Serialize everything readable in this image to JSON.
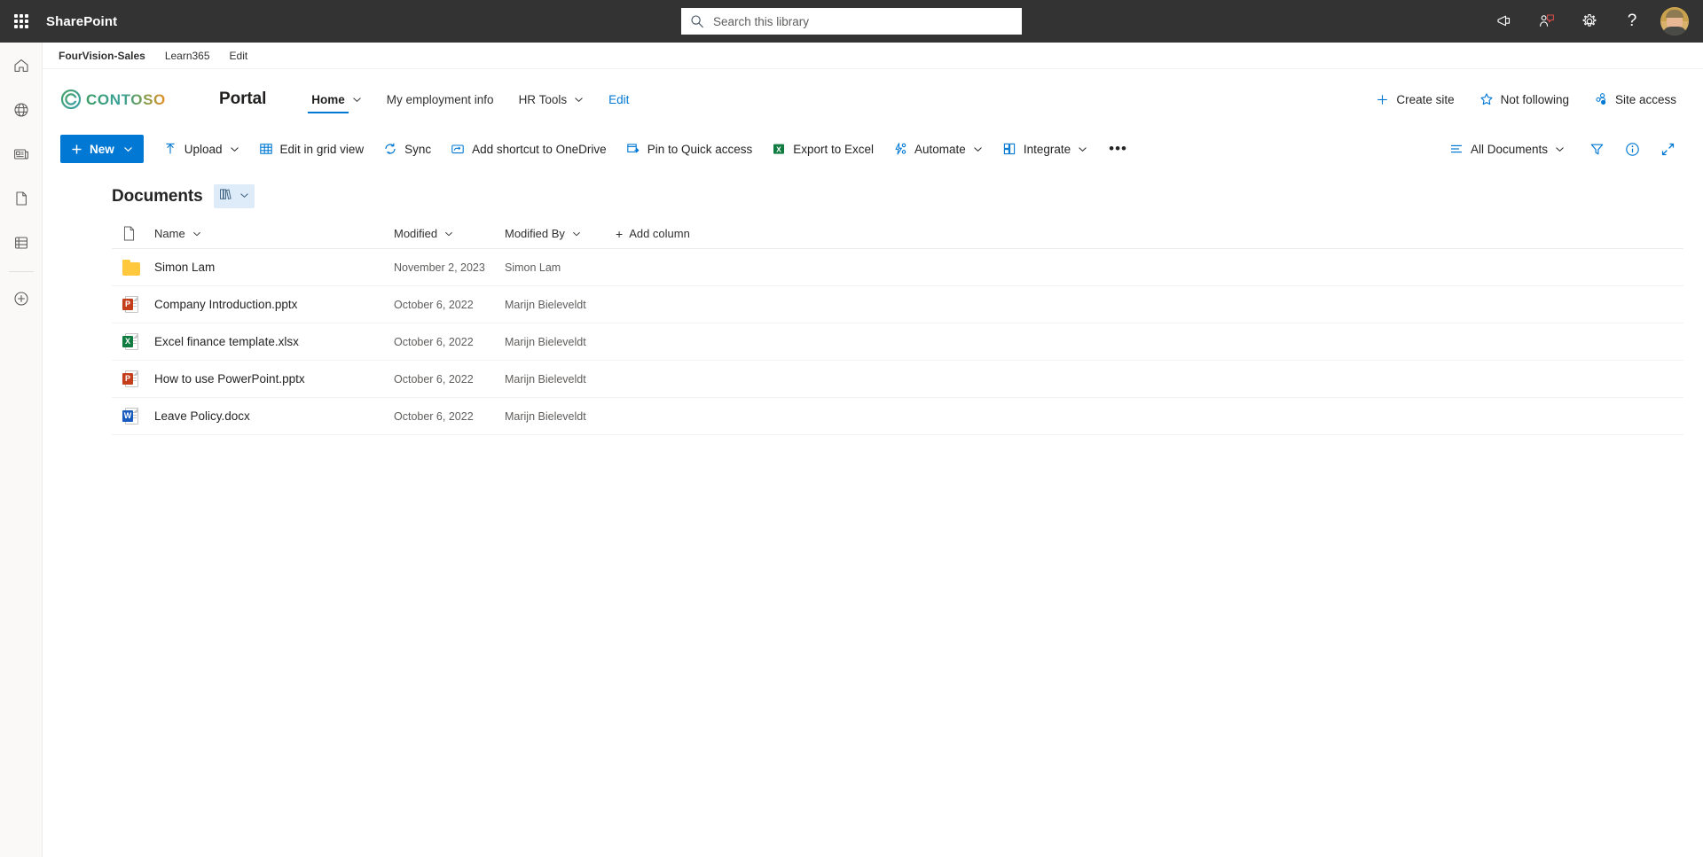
{
  "suite": {
    "waffle_label": "app-launcher",
    "app_name": "SharePoint",
    "search_placeholder": "Search this library",
    "search_value": "",
    "icons": [
      {
        "name": "megaphone-icon",
        "label": "Announcements"
      },
      {
        "name": "feedback-icon",
        "label": "Feedback"
      },
      {
        "name": "gear-icon",
        "label": "Settings"
      },
      {
        "name": "help-icon",
        "label": "?"
      }
    ],
    "avatar_label": "User account"
  },
  "rail": {
    "items": [
      {
        "name": "home-icon",
        "label": "Home"
      },
      {
        "name": "globe-icon",
        "label": "My sites"
      },
      {
        "name": "news-icon",
        "label": "News"
      },
      {
        "name": "page-icon",
        "label": "Files"
      },
      {
        "name": "lists-icon",
        "label": "Lists"
      },
      {
        "name": "create-icon",
        "label": "Create"
      }
    ]
  },
  "hubnav": {
    "items": [
      {
        "label": "FourVision-Sales",
        "bold": true
      },
      {
        "label": "Learn365",
        "bold": false
      },
      {
        "label": "Edit",
        "bold": false
      }
    ]
  },
  "site_header": {
    "logo_text": "CONTOSO",
    "site_title": "Portal",
    "nav": [
      {
        "label": "Home",
        "active": true,
        "has_chevron": true
      },
      {
        "label": "My employment info",
        "active": false,
        "has_chevron": false
      },
      {
        "label": "HR Tools",
        "active": false,
        "has_chevron": true
      },
      {
        "label": "Edit",
        "active": false,
        "has_chevron": false,
        "link": true
      }
    ],
    "actions": [
      {
        "label": "Create site",
        "icon": "plus-icon"
      },
      {
        "label": "Not following",
        "icon": "star-icon"
      },
      {
        "label": "Site access",
        "icon": "people-icon"
      }
    ]
  },
  "command_bar": {
    "new_label": "New",
    "commands": [
      {
        "label": "Upload",
        "icon": "upload-icon",
        "chevron": true
      },
      {
        "label": "Edit in grid view",
        "icon": "grid-icon",
        "chevron": false
      },
      {
        "label": "Sync",
        "icon": "sync-icon",
        "chevron": false
      },
      {
        "label": "Add shortcut to OneDrive",
        "icon": "onedrive-shortcut-icon",
        "chevron": false
      },
      {
        "label": "Pin to Quick access",
        "icon": "pin-icon",
        "chevron": false
      },
      {
        "label": "Export to Excel",
        "icon": "excel-icon",
        "chevron": false
      },
      {
        "label": "Automate",
        "icon": "automate-icon",
        "chevron": true
      },
      {
        "label": "Integrate",
        "icon": "integrate-icon",
        "chevron": true
      }
    ],
    "overflow_label": "•••",
    "view_label": "All Documents",
    "right_icons": [
      {
        "name": "filter-icon",
        "label": "Filters"
      },
      {
        "name": "info-icon",
        "label": "Details"
      },
      {
        "name": "expand-icon",
        "label": "Expand"
      }
    ]
  },
  "library": {
    "title": "Documents",
    "pill_icon": "library-books-icon",
    "columns": [
      {
        "key": "name",
        "label": "Name"
      },
      {
        "key": "modified",
        "label": "Modified"
      },
      {
        "key": "modified_by",
        "label": "Modified By"
      }
    ],
    "add_column_label": "Add column",
    "rows": [
      {
        "icon": "folder",
        "name": "Simon Lam",
        "modified": "November 2, 2023",
        "modified_by": "Simon Lam"
      },
      {
        "icon": "pptx",
        "name": "Company Introduction.pptx",
        "modified": "October 6, 2022",
        "modified_by": "Marijn Bieleveldt"
      },
      {
        "icon": "xlsx",
        "name": "Excel finance template.xlsx",
        "modified": "October 6, 2022",
        "modified_by": "Marijn Bieleveldt"
      },
      {
        "icon": "pptx",
        "name": "How to use PowerPoint.pptx",
        "modified": "October 6, 2022",
        "modified_by": "Marijn Bieleveldt"
      },
      {
        "icon": "docx",
        "name": "Leave Policy.docx",
        "modified": "October 6, 2022",
        "modified_by": "Marijn Bieleveldt"
      }
    ]
  },
  "colors": {
    "suitebar_bg": "#333333",
    "accent": "#0078d4",
    "folder": "#ffc83d",
    "excel": "#107c41",
    "powerpoint": "#c43e1c",
    "word": "#185abd"
  }
}
